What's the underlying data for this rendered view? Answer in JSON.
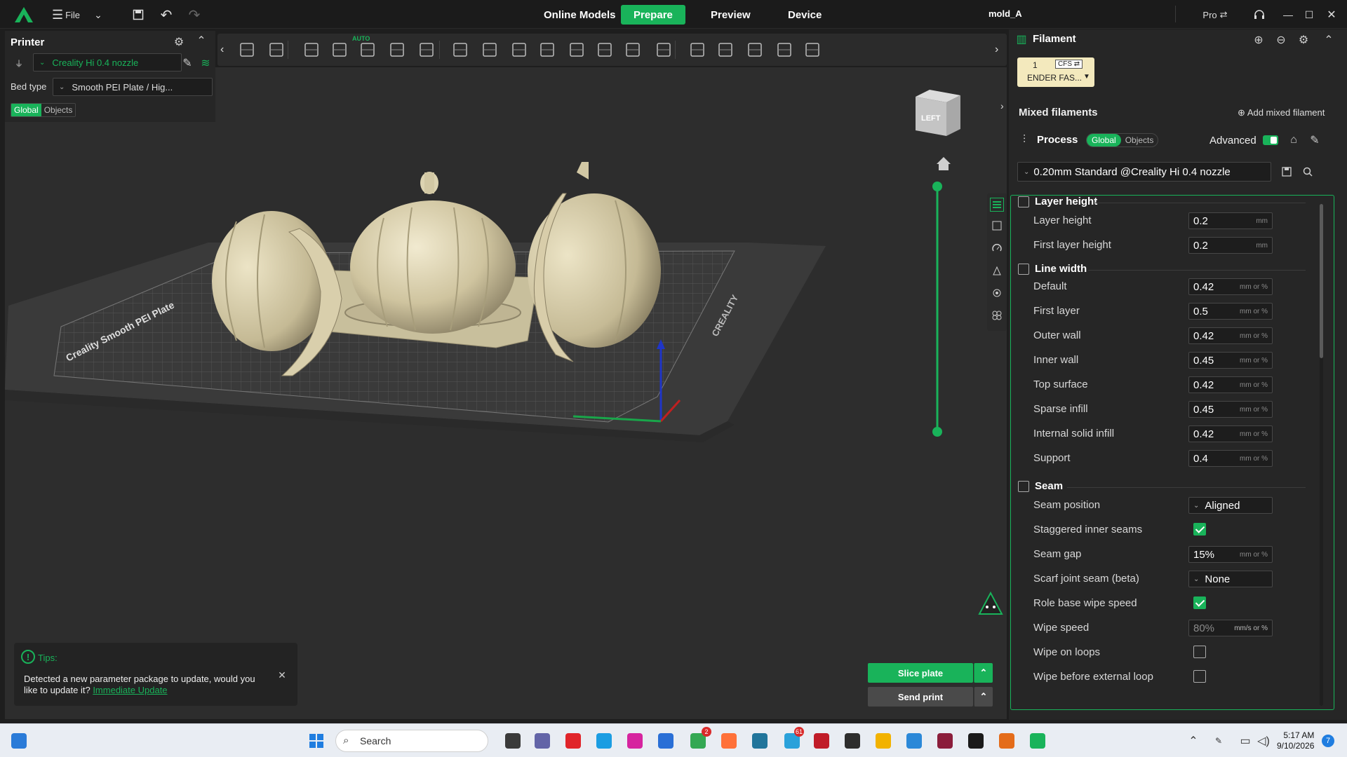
{
  "titlebar": {
    "file_label": "File",
    "tabs": [
      "Online Models",
      "Prepare",
      "Preview",
      "Device"
    ],
    "active_tab": "Prepare",
    "project_name": "mold_A",
    "pro_label": "Pro"
  },
  "printer_panel": {
    "title": "Printer",
    "printer_name": "Creality Hi 0.4 nozzle",
    "bed_type_label": "Bed type",
    "bed_type_value": "Smooth PEI Plate / Hig...",
    "scope_tabs": [
      "Global",
      "Objects"
    ],
    "active_scope": "Global"
  },
  "toolbar": {
    "auto_label": "AUTO",
    "icons": [
      "add-cube-icon",
      "add-plate-icon",
      "orient-icon",
      "arrange-icon",
      "auto-orient-icon",
      "layout-icon",
      "lay-on-face-icon",
      "grid-icon",
      "split-objects-icon",
      "split-parts-icon",
      "scale-icon",
      "cut-icon",
      "hollow-icon",
      "boolean-icon",
      "measure-icon",
      "support-paint-icon",
      "seam-paint-icon",
      "fuzzy-skin-icon",
      "variable-layer-icon",
      "assembly-icon"
    ]
  },
  "viewport": {
    "view_cube_label": "LEFT",
    "bed_text_left": "Creality Smooth PEI Plate",
    "bed_text_right": "CREALITY"
  },
  "tips": {
    "title": "Tips:",
    "message": "Detected a new parameter package to update, would you like to update it?",
    "link": "Immediate Update"
  },
  "actions": {
    "slice_label": "Slice plate",
    "send_label": "Send print"
  },
  "filament": {
    "title": "Filament",
    "slot_number": "1",
    "cfs_label": "CFS",
    "slot_name": "ENDER FAS...",
    "slot_color": "#f3e9bd",
    "mixed_label": "Mixed filaments",
    "add_mixed_label": "Add mixed filament"
  },
  "process": {
    "title": "Process",
    "scope_tabs": [
      "Global",
      "Objects"
    ],
    "active_scope": "Global",
    "advanced_label": "Advanced",
    "advanced_on": true,
    "preset": "0.20mm Standard @Creality Hi 0.4 nozzle"
  },
  "groups": {
    "layer_height": {
      "title": "Layer height",
      "rows": [
        {
          "label": "Layer height",
          "value": "0.2",
          "unit": "mm"
        },
        {
          "label": "First layer height",
          "value": "0.2",
          "unit": "mm"
        }
      ]
    },
    "line_width": {
      "title": "Line width",
      "rows": [
        {
          "label": "Default",
          "value": "0.42",
          "unit": "mm or %"
        },
        {
          "label": "First layer",
          "value": "0.5",
          "unit": "mm or %"
        },
        {
          "label": "Outer wall",
          "value": "0.42",
          "unit": "mm or %"
        },
        {
          "label": "Inner wall",
          "value": "0.45",
          "unit": "mm or %"
        },
        {
          "label": "Top surface",
          "value": "0.42",
          "unit": "mm or %"
        },
        {
          "label": "Sparse infill",
          "value": "0.45",
          "unit": "mm or %"
        },
        {
          "label": "Internal solid infill",
          "value": "0.42",
          "unit": "mm or %"
        },
        {
          "label": "Support",
          "value": "0.4",
          "unit": "mm or %"
        }
      ]
    },
    "seam": {
      "title": "Seam",
      "seam_position_label": "Seam position",
      "seam_position_value": "Aligned",
      "staggered_label": "Staggered inner seams",
      "staggered_checked": true,
      "seam_gap_label": "Seam gap",
      "seam_gap_value": "15%",
      "seam_gap_unit": "mm or %",
      "scarf_label": "Scarf joint seam (beta)",
      "scarf_value": "None",
      "role_wipe_label": "Role base wipe speed",
      "role_wipe_checked": true,
      "wipe_speed_label": "Wipe speed",
      "wipe_speed_value": "80%",
      "wipe_speed_unit": "mm/s or %",
      "wipe_loops_label": "Wipe on loops",
      "wipe_loops_checked": false,
      "wipe_before_label": "Wipe before external loop",
      "wipe_before_checked": false
    }
  },
  "taskbar": {
    "search_placeholder": "Search",
    "time": "5:17 AM",
    "date": "9/10/2026",
    "notification_count": "7",
    "chrome_badge": "2",
    "telegram_badge": "61"
  }
}
